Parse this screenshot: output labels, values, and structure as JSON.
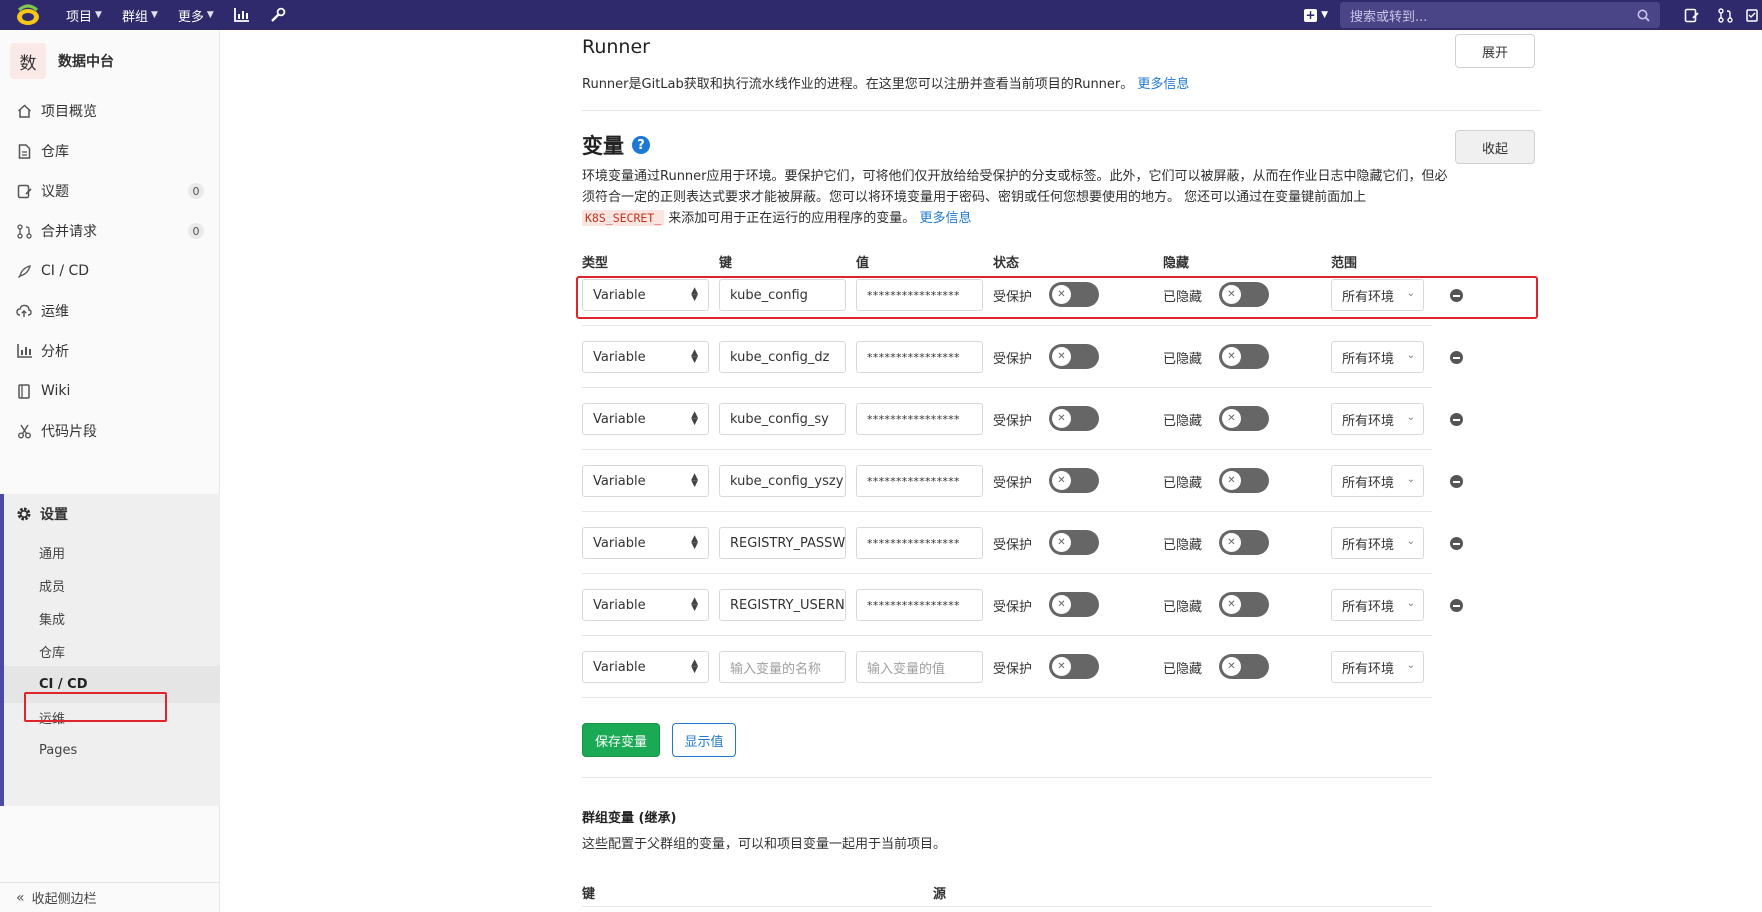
{
  "topnav": {
    "projects": "项目",
    "groups": "群组",
    "more": "更多",
    "search_placeholder": "搜索或转到..."
  },
  "sidebar": {
    "project_avatar": "数",
    "project_name": "数据中台",
    "items": [
      {
        "label": "项目概览"
      },
      {
        "label": "仓库"
      },
      {
        "label": "议题",
        "badge": "0"
      },
      {
        "label": "合并请求",
        "badge": "0"
      },
      {
        "label": "CI / CD"
      },
      {
        "label": "运维"
      },
      {
        "label": "分析"
      },
      {
        "label": "Wiki"
      },
      {
        "label": "代码片段"
      }
    ],
    "settings": {
      "label": "设置",
      "sub": [
        "通用",
        "成员",
        "集成",
        "仓库",
        "CI / CD",
        "运维",
        "Pages"
      ]
    },
    "collapse": "收起侧边栏"
  },
  "runner": {
    "title": "Runner",
    "desc": "Runner是GitLab获取和执行流水线作业的进程。在这里您可以注册并查看当前项目的Runner。",
    "more": "更多信息",
    "expand": "展开"
  },
  "variables": {
    "title": "变量",
    "collapse": "收起",
    "desc_part1": "环境变量通过Runner应用于环境。要保护它们，可将他们仅开放给给受保护的分支或标签。此外，它们可以被屏蔽，从而在作业日志中隐藏它们，但必须符合一定的正则表达式要求才能被屏蔽。您可以将环境变量用于密码、密钥或任何您想要使用的地方。 您还可以通过在变量键前面加上 ",
    "desc_code": "K8S_SECRET_",
    "desc_part2": " 来添加可用于正在运行的应用程序的变量。",
    "more": "更多信息",
    "columns": {
      "type": "类型",
      "key": "键",
      "value": "值",
      "state": "状态",
      "masked": "隐藏",
      "scope": "范围"
    },
    "rows": [
      {
        "type": "Variable",
        "key": "kube_config",
        "value": "****************",
        "protected": "受保护",
        "masked": "已隐藏",
        "scope": "所有环境"
      },
      {
        "type": "Variable",
        "key": "kube_config_dz",
        "value": "****************",
        "protected": "受保护",
        "masked": "已隐藏",
        "scope": "所有环境"
      },
      {
        "type": "Variable",
        "key": "kube_config_sy",
        "value": "****************",
        "protected": "受保护",
        "masked": "已隐藏",
        "scope": "所有环境"
      },
      {
        "type": "Variable",
        "key": "kube_config_yszy",
        "value": "****************",
        "protected": "受保护",
        "masked": "已隐藏",
        "scope": "所有环境"
      },
      {
        "type": "Variable",
        "key": "REGISTRY_PASSW",
        "value": "****************",
        "protected": "受保护",
        "masked": "已隐藏",
        "scope": "所有环境"
      },
      {
        "type": "Variable",
        "key": "REGISTRY_USERN",
        "value": "****************",
        "protected": "受保护",
        "masked": "已隐藏",
        "scope": "所有环境"
      }
    ],
    "new_row": {
      "type": "Variable",
      "key_placeholder": "输入变量的名称",
      "value_placeholder": "输入变量的值",
      "protected": "受保护",
      "masked": "已隐藏",
      "scope": "所有环境"
    },
    "save": "保存变量",
    "reveal": "显示值"
  },
  "group_vars": {
    "title": "群组变量 (继承)",
    "desc": "这些配置于父群组的变量，可以和项目变量一起用于当前项目。",
    "col_key": "键",
    "col_source": "源"
  }
}
